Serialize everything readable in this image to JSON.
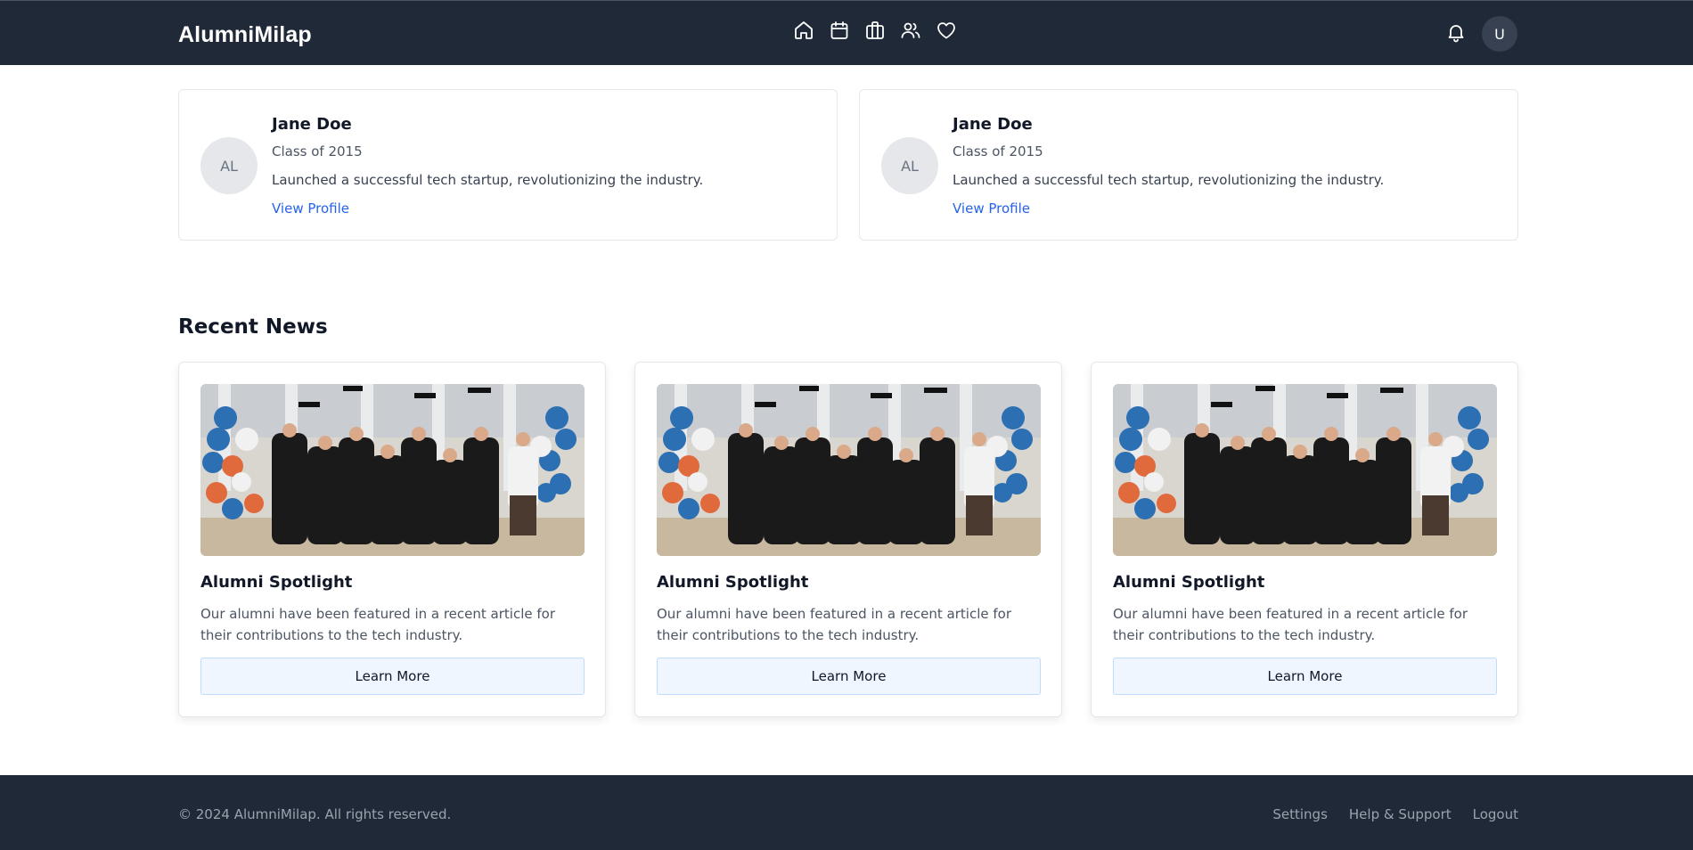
{
  "header": {
    "brand": "AlumniMilap",
    "nav_icons": [
      "home-icon",
      "calendar-icon",
      "briefcase-icon",
      "users-icon",
      "heart-icon"
    ],
    "notification_icon": "bell-icon",
    "user_initial": "U"
  },
  "profiles": [
    {
      "initials": "AL",
      "name": "Jane Doe",
      "class": "Class of 2015",
      "description": "Launched a successful tech startup, revolutionizing the industry.",
      "link": "View Profile"
    },
    {
      "initials": "AL",
      "name": "Jane Doe",
      "class": "Class of 2015",
      "description": "Launched a successful tech startup, revolutionizing the industry.",
      "link": "View Profile"
    }
  ],
  "news": {
    "title": "Recent News",
    "items": [
      {
        "title": "Alumni Spotlight",
        "description": "Our alumni have been featured in a recent article for their contributions to the tech industry.",
        "button": "Learn More"
      },
      {
        "title": "Alumni Spotlight",
        "description": "Our alumni have been featured in a recent article for their contributions to the tech industry.",
        "button": "Learn More"
      },
      {
        "title": "Alumni Spotlight",
        "description": "Our alumni have been featured in a recent article for their contributions to the tech industry.",
        "button": "Learn More"
      }
    ]
  },
  "footer": {
    "copyright": "© 2024 AlumniMilap. All rights reserved.",
    "links": [
      "Settings",
      "Help & Support",
      "Logout"
    ]
  },
  "colors": {
    "header_bg": "#1f2937",
    "link": "#2563eb",
    "button_bg": "#eff6ff"
  }
}
